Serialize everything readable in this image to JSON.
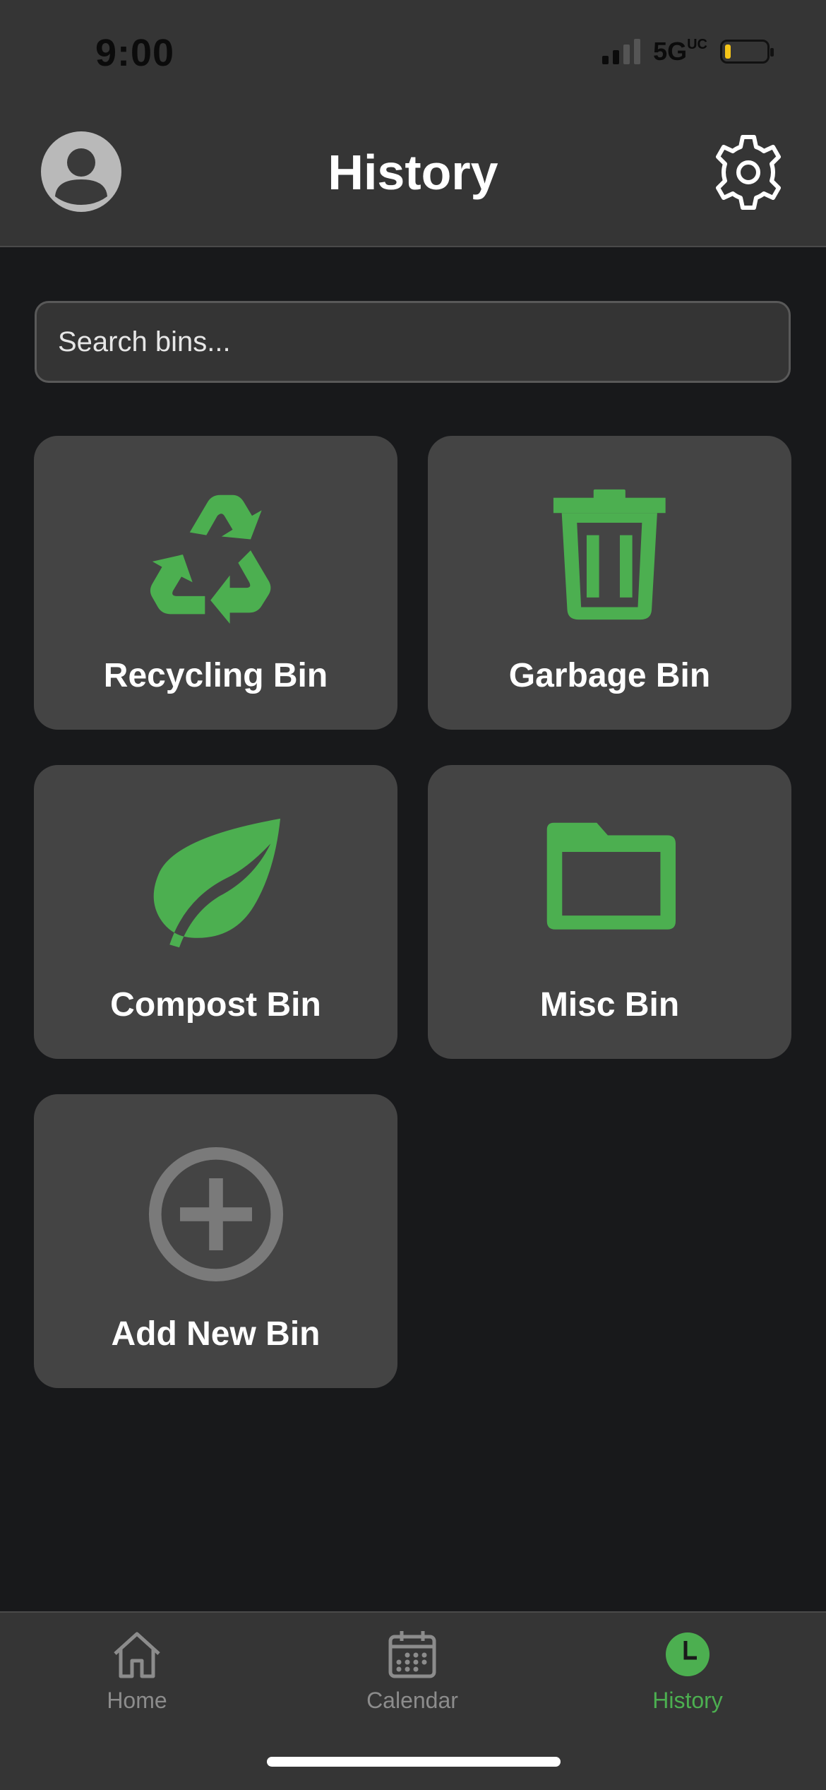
{
  "status_bar": {
    "time": "9:00",
    "network": "5G",
    "network_sub": "UC"
  },
  "header": {
    "title": "History",
    "profile_icon": "user-avatar-icon",
    "settings_icon": "gear-icon"
  },
  "search": {
    "placeholder": "Search bins...",
    "value": ""
  },
  "bins": [
    {
      "label": "Recycling Bin",
      "icon": "recycle-icon",
      "color": "#4caf50"
    },
    {
      "label": "Garbage Bin",
      "icon": "trash-icon",
      "color": "#4caf50"
    },
    {
      "label": "Compost Bin",
      "icon": "leaf-icon",
      "color": "#4caf50"
    },
    {
      "label": "Misc Bin",
      "icon": "folder-icon",
      "color": "#4caf50"
    },
    {
      "label": "Add New Bin",
      "icon": "add-circle-icon",
      "color": "#7a7a7a"
    }
  ],
  "nav": {
    "items": [
      {
        "label": "Home",
        "icon": "home-icon",
        "active": false
      },
      {
        "label": "Calendar",
        "icon": "calendar-icon",
        "active": false
      },
      {
        "label": "History",
        "icon": "clock-icon",
        "active": true
      }
    ]
  },
  "colors": {
    "accent": "#4caf50",
    "background": "#18191b",
    "card": "#444444",
    "bar": "#353535"
  }
}
